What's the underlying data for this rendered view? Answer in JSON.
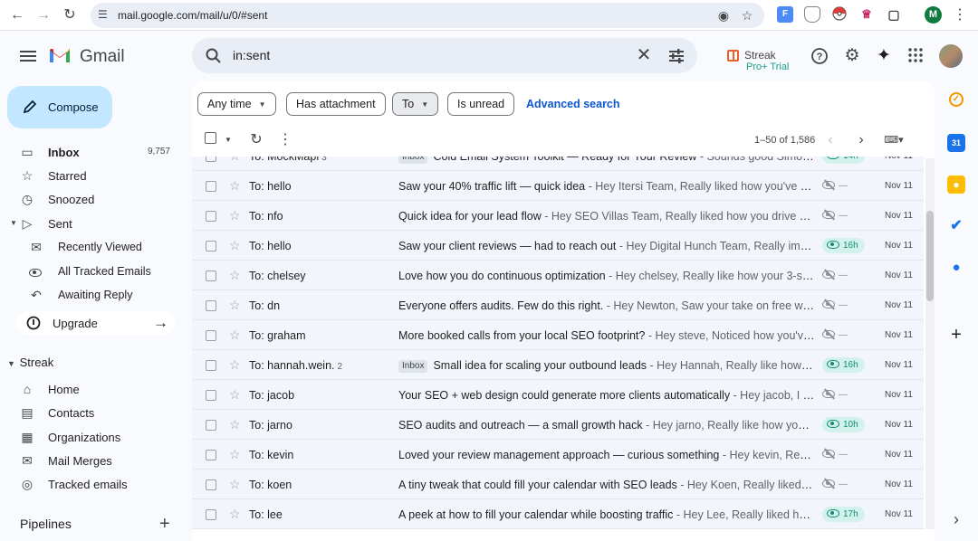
{
  "browser": {
    "url": "mail.google.com/mail/u/0/#sent",
    "profile_initial": "M"
  },
  "app": {
    "name": "Gmail"
  },
  "search": {
    "query": "in:sent"
  },
  "streak_badge": {
    "name": "Streak",
    "trial": "Pro+ Trial"
  },
  "compose": {
    "label": "Compose"
  },
  "nav": {
    "items": [
      {
        "label": "Inbox",
        "count": "9,757"
      },
      {
        "label": "Starred"
      },
      {
        "label": "Snoozed"
      },
      {
        "label": "Sent"
      }
    ],
    "sent_sub": [
      {
        "label": "Recently Viewed"
      },
      {
        "label": "All Tracked Emails"
      },
      {
        "label": "Awaiting Reply"
      }
    ],
    "upgrade": "Upgrade"
  },
  "streak": {
    "section": "Streak",
    "items": [
      {
        "label": "Home"
      },
      {
        "label": "Contacts"
      },
      {
        "label": "Organizations"
      },
      {
        "label": "Mail Merges"
      },
      {
        "label": "Tracked emails"
      }
    ],
    "pipelines": "Pipelines"
  },
  "filters": {
    "any_time": "Any time",
    "has_attachment": "Has attachment",
    "to": "To",
    "is_unread": "Is unread",
    "advanced": "Advanced search"
  },
  "pagination": {
    "range": "1–50 of 1,586"
  },
  "emails": [
    {
      "to": "To: MockMapi",
      "count": "3",
      "label": "Inbox",
      "subject": "Cold Email System Toolkit — Ready for Your Review",
      "snippet": " - Sounds good Simon, loo...",
      "track": "14h",
      "date": "Nov 11"
    },
    {
      "to": "To: hello",
      "count": "",
      "label": "",
      "subject": "Saw your 40% traffic lift — quick idea",
      "snippet": " - Hey Itersi Team, Really liked how you've helpe...",
      "track": "—",
      "date": "Nov 11"
    },
    {
      "to": "To: nfo",
      "count": "",
      "label": "",
      "subject": "Quick idea for your lead flow",
      "snippet": " - Hey SEO Villas Team, Really liked how you drive measur...",
      "track": "—",
      "date": "Nov 11"
    },
    {
      "to": "To: hello",
      "count": "",
      "label": "",
      "subject": "Saw your client reviews — had to reach out",
      "snippet": " - Hey Digital Hunch Team, Really impress...",
      "track": "16h",
      "date": "Nov 11"
    },
    {
      "to": "To: chelsey",
      "count": "",
      "label": "",
      "subject": "Love how you do continuous optimization",
      "snippet": " - Hey chelsey, Really like how your 3-step pr...",
      "track": "—",
      "date": "Nov 11"
    },
    {
      "to": "To: dn",
      "count": "",
      "label": "",
      "subject": "Everyone offers audits. Few do this right.",
      "snippet": " - Hey Newton, Saw your take on free website...",
      "track": "—",
      "date": "Nov 11"
    },
    {
      "to": "To: graham",
      "count": "",
      "label": "",
      "subject": "More booked calls from your local SEO footprint?",
      "snippet": " - Hey steve, Noticed how you've buil...",
      "track": "—",
      "date": "Nov 11"
    },
    {
      "to": "To: hannah.wein.",
      "count": "2",
      "label": "Inbox",
      "subject": "Small idea for scaling your outbound leads",
      "snippet": " - Hey Hannah, Really like how you ...",
      "track": "16h",
      "date": "Nov 11"
    },
    {
      "to": "To: jacob",
      "count": "",
      "label": "",
      "subject": "Your SEO + web design could generate more clients automatically",
      "snippet": " - Hey jacob, I love h...",
      "track": "—",
      "date": "Nov 11"
    },
    {
      "to": "To: jarno",
      "count": "",
      "label": "",
      "subject": "SEO audits and outreach — a small growth hack",
      "snippet": " - Hey jarno, Really like how you com...",
      "track": "10h",
      "date": "Nov 11"
    },
    {
      "to": "To: kevin",
      "count": "",
      "label": "",
      "subject": "Loved your review management approach — curious something",
      "snippet": " - Hey kevin, Really im...",
      "track": "—",
      "date": "Nov 11"
    },
    {
      "to": "To: koen",
      "count": "",
      "label": "",
      "subject": "A tiny tweak that could fill your calendar with SEO leads",
      "snippet": " - Hey Koen, Really liked how ...",
      "track": "—",
      "date": "Nov 11"
    },
    {
      "to": "To: lee",
      "count": "",
      "label": "",
      "subject": "A peek at how to fill your calendar while boosting traffic",
      "snippet": " - Hey Lee, Really liked how y...",
      "track": "17h",
      "date": "Nov 11"
    }
  ]
}
